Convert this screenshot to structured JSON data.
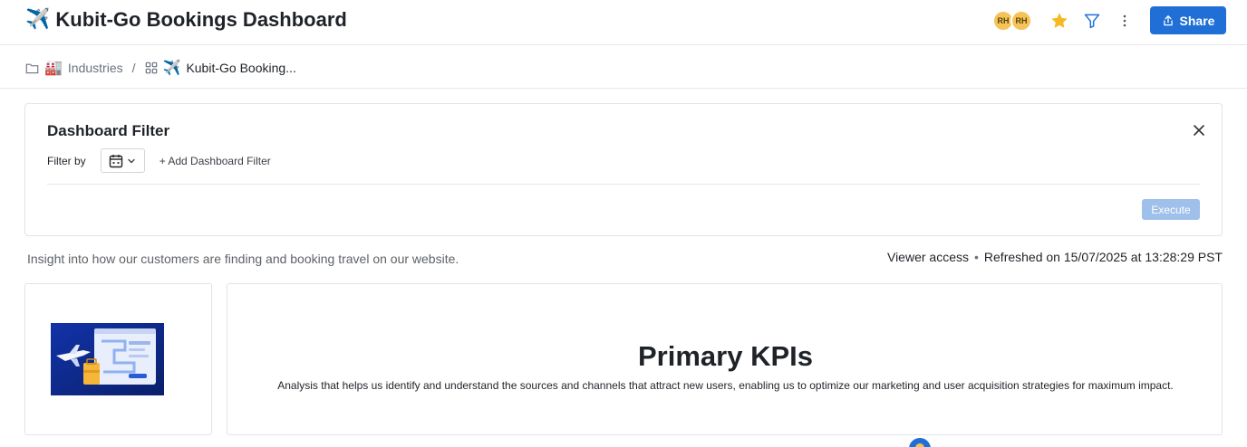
{
  "header": {
    "title_emoji": "✈️",
    "title": "Kubit-Go Bookings Dashboard",
    "avatars": [
      "RH",
      "RH"
    ],
    "star_icon": "star-icon",
    "filter_icon": "filter-icon",
    "more_icon": "more-vertical-icon",
    "share_label": "Share",
    "share_icon": "share-icon",
    "accent_color": "#1f6fd6",
    "star_color": "#f5b924",
    "avatar_color": "#f5c35a"
  },
  "breadcrumb": {
    "folder_icon": "folder-icon",
    "parent_emoji": "🏭",
    "parent_label": "Industries",
    "separator": "/",
    "dashboard_icon": "dashboard-grid-icon",
    "current_emoji": "✈️",
    "current_label": "Kubit-Go Booking..."
  },
  "filter_panel": {
    "title": "Dashboard Filter",
    "filter_by_label": "Filter by",
    "date_icon": "calendar-icon",
    "add_filter_label": "+ Add Dashboard Filter",
    "execute_label": "Execute",
    "close_icon": "close-icon"
  },
  "info": {
    "description": "Insight into how our customers are finding and booking travel on our website.",
    "access": "Viewer access",
    "bullet": "•",
    "refreshed": "Refreshed on 15/07/2025 at 13:28:29 PST"
  },
  "kpi_card": {
    "title": "Primary KPIs",
    "description": "Analysis that helps us identify and understand the sources and channels that attract new users, enabling us to optimize our marketing and user acquisition strategies for maximum impact."
  },
  "image_card": {
    "image_name": "travel-booking-illustration"
  }
}
